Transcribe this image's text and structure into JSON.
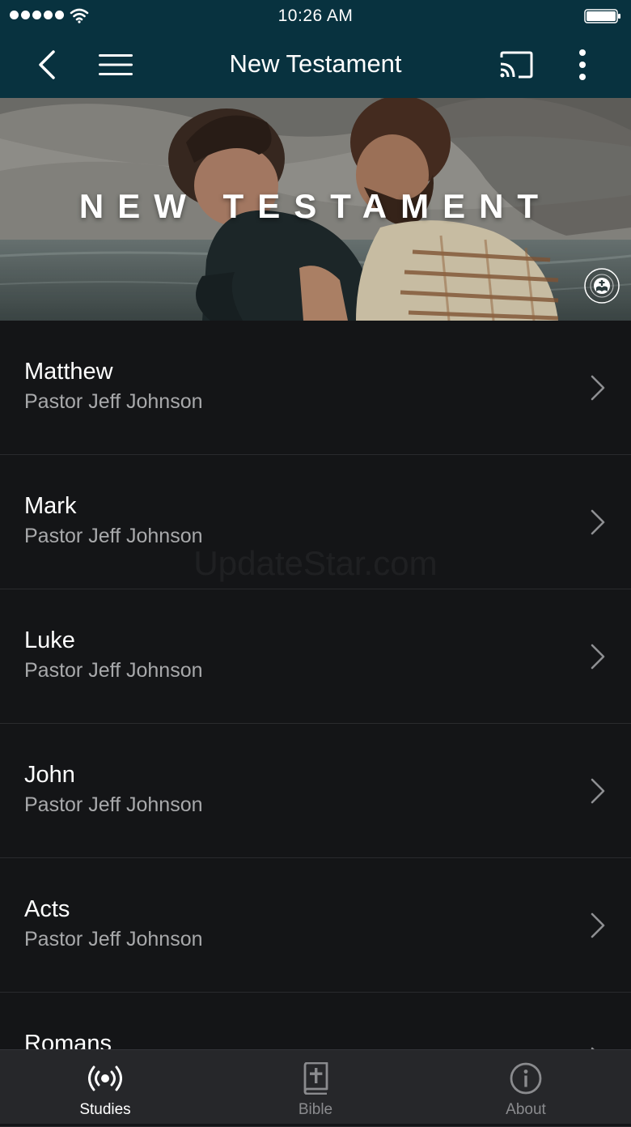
{
  "status_bar": {
    "time": "10:26 AM"
  },
  "nav": {
    "title": "New Testament"
  },
  "hero": {
    "title": "NEW TESTAMENT"
  },
  "studies": [
    {
      "title": "Matthew",
      "subtitle": "Pastor Jeff Johnson"
    },
    {
      "title": "Mark",
      "subtitle": "Pastor Jeff Johnson"
    },
    {
      "title": "Luke",
      "subtitle": "Pastor Jeff Johnson"
    },
    {
      "title": "John",
      "subtitle": "Pastor Jeff Johnson"
    },
    {
      "title": "Acts",
      "subtitle": "Pastor Jeff Johnson"
    },
    {
      "title": "Romans",
      "subtitle": ""
    }
  ],
  "watermark": "UpdateStar.com",
  "tabs": [
    {
      "label": "Studies",
      "icon": "broadcast-icon",
      "active": true
    },
    {
      "label": "Bible",
      "icon": "bible-icon",
      "active": false
    },
    {
      "label": "About",
      "icon": "info-icon",
      "active": false
    }
  ],
  "colors": {
    "nav_background": "#08323f",
    "list_background": "#141517",
    "tab_bar_background": "#26272a",
    "tab_active": "#ffffff",
    "tab_inactive": "#8a8b8e",
    "subtitle_text": "#a8a9ab"
  }
}
